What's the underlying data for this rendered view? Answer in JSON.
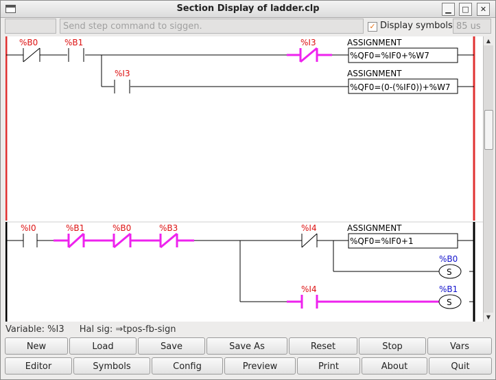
{
  "window": {
    "title": "Section Display of ladder.clp"
  },
  "toolbar": {
    "command_placeholder": "Send step command to siggen.",
    "display_symbols_label": "Display symbols",
    "display_symbols_checked": true,
    "cycle_time": "85 us"
  },
  "ladder": {
    "rung1": {
      "contact1": "%B0",
      "contact2": "%B1",
      "contact3": "%I3",
      "branch_contact": "%I3",
      "block1_title": "ASSIGNMENT",
      "block1_expr": "%QF0=%IF0+%W7",
      "block2_title": "ASSIGNMENT",
      "block2_expr": "%QF0=(0-(%IF0))+%W7"
    },
    "rung2": {
      "contact1": "%I0",
      "contact2": "%B1",
      "contact3": "%B0",
      "contact4": "%B3",
      "contact5": "%I4",
      "branch_contact": "%I4",
      "block_title": "ASSIGNMENT",
      "block_expr": "%QF0=%IF0+1",
      "coil1_name": "%B0",
      "coil1_type": "S",
      "coil2_name": "%B1",
      "coil2_type": "S"
    },
    "colors": {
      "active": "#ee22ee",
      "rail_active": "#e03030",
      "wire": "#000000",
      "label": "#dd1111",
      "coil_label": "#1111cc"
    }
  },
  "status": {
    "variable": "Variable: %I3",
    "hal_sig": "Hal sig: ⇒tpos-fb-sign"
  },
  "buttons": {
    "row1": [
      "New",
      "Load",
      "Save",
      "Save As",
      "Reset",
      "Stop",
      "Vars"
    ],
    "row2": [
      "Editor",
      "Symbols",
      "Config",
      "Preview",
      "Print",
      "About",
      "Quit"
    ]
  }
}
